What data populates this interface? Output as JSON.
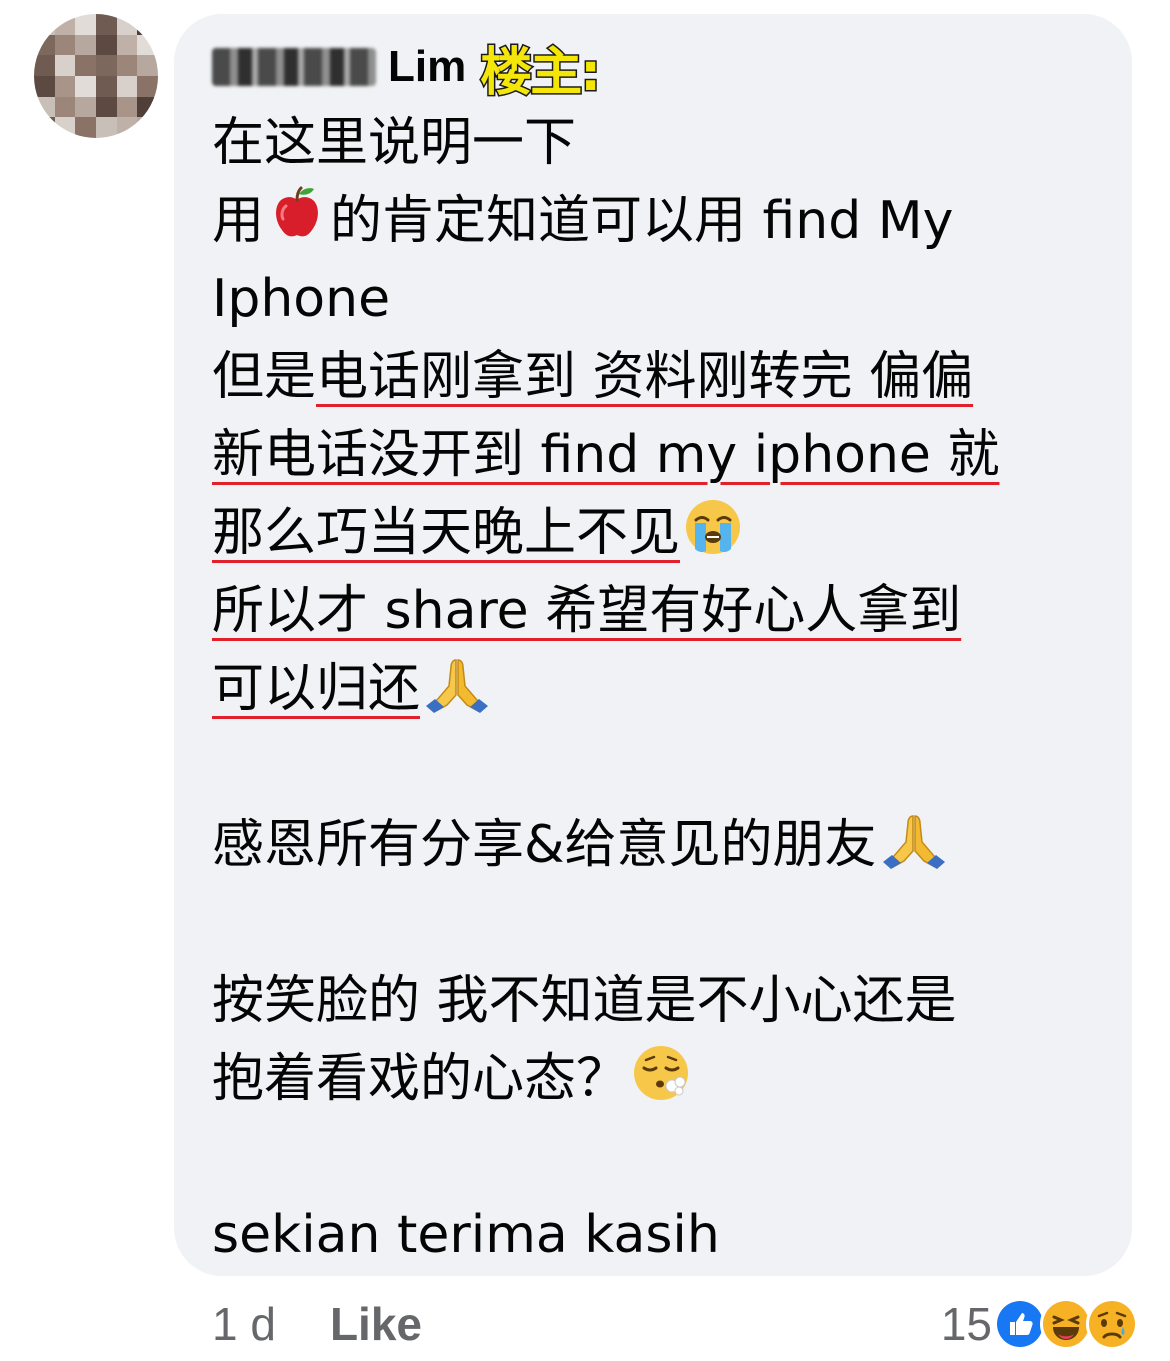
{
  "comment": {
    "author_last_name": "Lim",
    "op_badge": "楼主:",
    "lines": [
      {
        "segments": [
          {
            "text": "在这里说明一下"
          }
        ]
      },
      {
        "segments": [
          {
            "text": "用"
          },
          {
            "emoji": "apple-emoji"
          },
          {
            "text": "的肯定知道可以用 find My"
          }
        ]
      },
      {
        "segments": [
          {
            "text": "Iphone"
          }
        ]
      },
      {
        "segments": [
          {
            "text": "但是"
          },
          {
            "text": "电话刚拿到 资料刚转完 偏偏",
            "underline": true
          }
        ]
      },
      {
        "segments": [
          {
            "text": "新电话没开到 find my iphone 就",
            "underline": true
          }
        ]
      },
      {
        "segments": [
          {
            "text": "那么巧当天晚上不见",
            "underline": true
          },
          {
            "emoji": "loudly-crying-emoji"
          }
        ]
      },
      {
        "segments": [
          {
            "text": "所以才 share 希望有好心人拿到",
            "underline": true
          }
        ]
      },
      {
        "segments": [
          {
            "text": "可以归还",
            "underline": true
          },
          {
            "emoji": "folded-hands-emoji"
          }
        ]
      },
      {
        "segments": []
      },
      {
        "segments": [
          {
            "text": "感恩所有分享&给意见的朋友"
          },
          {
            "emoji": "folded-hands-emoji"
          }
        ]
      },
      {
        "segments": []
      },
      {
        "segments": [
          {
            "text": "按笑脸的 我不知道是不小心还是"
          }
        ]
      },
      {
        "segments": [
          {
            "text": "抱着看戏的心态？"
          },
          {
            "emoji": "face-exhaling-emoji"
          }
        ]
      },
      {
        "segments": []
      },
      {
        "segments": [
          {
            "text": "sekian terima kasih"
          }
        ]
      }
    ]
  },
  "meta": {
    "time": "1 d",
    "like_label": "Like"
  },
  "reactions": {
    "count": "15",
    "icons": [
      "like-reaction-icon",
      "haha-reaction-icon",
      "sad-reaction-icon"
    ]
  },
  "colors": {
    "bubble": "#f0f2f5",
    "underline": "#e0202a",
    "badge": "#f5e60a",
    "meta_text": "#65676b",
    "like_blue": "#1877f2"
  }
}
